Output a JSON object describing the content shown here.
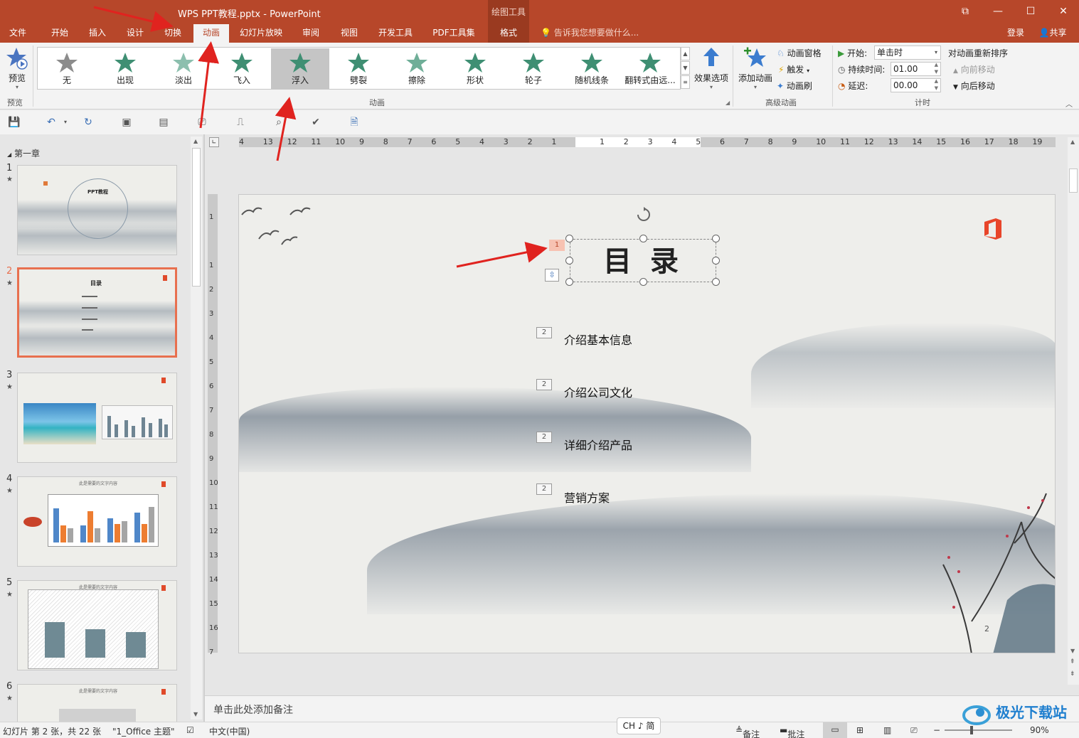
{
  "window": {
    "title": "WPS PPT教程.pptx - PowerPoint",
    "context_tool_title": "绘图工具",
    "controls": {
      "restore": "⧉",
      "minimize": "—",
      "maximize": "☐",
      "close": "✕"
    }
  },
  "tabs": [
    "文件",
    "开始",
    "插入",
    "设计",
    "切换",
    "动画",
    "幻灯片放映",
    "审阅",
    "视图",
    "开发工具",
    "PDF工具集",
    "格式"
  ],
  "active_tab": "动画",
  "tell_me": "告诉我您想要做什么...",
  "account": {
    "login": "登录",
    "share": "共享"
  },
  "ribbon": {
    "preview": {
      "label": "预览",
      "group": "预览"
    },
    "animations_group": "动画",
    "gallery": [
      {
        "label": "无",
        "icon": "star-gray-icon",
        "color": "#8c8c8c"
      },
      {
        "label": "出现",
        "icon": "star-burst-icon",
        "color": "#3f8f73"
      },
      {
        "label": "淡出",
        "icon": "star-fade-icon",
        "color": "#8cbfae"
      },
      {
        "label": "飞入",
        "icon": "star-fly-icon",
        "color": "#3f8f73"
      },
      {
        "label": "浮入",
        "icon": "star-float-icon",
        "color": "#3f8f73"
      },
      {
        "label": "劈裂",
        "icon": "star-split-icon",
        "color": "#3f8f73"
      },
      {
        "label": "擦除",
        "icon": "star-wipe-icon",
        "color": "#6fae98"
      },
      {
        "label": "形状",
        "icon": "star-shape-icon",
        "color": "#3f8f73"
      },
      {
        "label": "轮子",
        "icon": "star-wheel-icon",
        "color": "#3f8f73"
      },
      {
        "label": "随机线条",
        "icon": "star-lines-icon",
        "color": "#3f8f73"
      },
      {
        "label": "翻转式由远...",
        "icon": "star-flip-icon",
        "color": "#3f8f73"
      }
    ],
    "selected_animation": "浮入",
    "effect_options": "效果选项",
    "advanced": {
      "group": "高级动画",
      "add": "添加动画",
      "pane": "动画窗格",
      "trigger": "触发",
      "painter": "动画刷"
    },
    "timing": {
      "group": "计时",
      "start_label": "开始:",
      "start_value": "单击时",
      "duration_label": "持续时间:",
      "duration_value": "01.00",
      "delay_label": "延迟:",
      "delay_value": "00.00",
      "reorder": "对动画重新排序",
      "move_earlier": "向前移动",
      "move_later": "向后移动"
    }
  },
  "thumbnails": {
    "section": "第一章",
    "selected": 2,
    "slides": [
      {
        "num": "1",
        "text": "PPT教程"
      },
      {
        "num": "2",
        "text": "目录"
      },
      {
        "num": "3",
        "text": ""
      },
      {
        "num": "4",
        "text": "此是需要的文字内容"
      },
      {
        "num": "5",
        "text": "此是需要的文字内容"
      },
      {
        "num": "6",
        "text": "此是需要的文字内容"
      }
    ]
  },
  "ruler": {
    "h_labels": [
      "4",
      "13",
      "12",
      "11",
      "10",
      "9",
      "8",
      "7",
      "6",
      "5",
      "4",
      "3",
      "2",
      "1",
      "",
      "1",
      "2",
      "3",
      "4",
      "5",
      "6",
      "7",
      "8",
      "9",
      "10",
      "11",
      "12",
      "13",
      "14",
      "15",
      "16",
      "17",
      "18",
      "19"
    ],
    "v_labels": [
      "1",
      "",
      "1",
      "2",
      "3",
      "4",
      "5",
      "6",
      "7",
      "8",
      "9",
      "10",
      "11",
      "12",
      "13",
      "14",
      "15",
      "16",
      "7"
    ]
  },
  "slide": {
    "title": "目 录",
    "title_anim_tag": "1",
    "items": [
      {
        "tag": "2",
        "text": "介绍基本信息"
      },
      {
        "tag": "2",
        "text": "介绍公司文化"
      },
      {
        "tag": "2",
        "text": "详细介绍产品"
      },
      {
        "tag": "2",
        "text": "营销方案"
      }
    ],
    "page_number": "2"
  },
  "notes_placeholder": "单击此处添加备注",
  "status": {
    "slide_info": "幻灯片 第 2 张，共 22 张",
    "theme": "\"1_Office 主题\"",
    "language": "中文(中国)",
    "notes": "备注",
    "comments": "批注",
    "zoom": "90%"
  },
  "ime": "CH ♪ 简",
  "watermark": "极光下载站"
}
